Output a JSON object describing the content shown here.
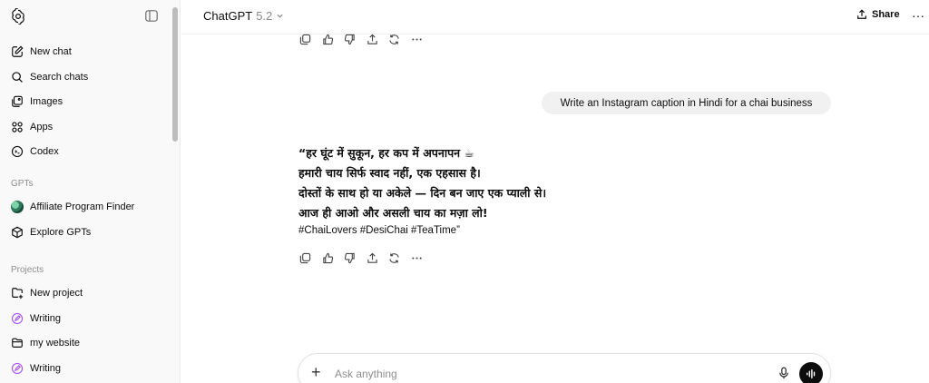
{
  "sidebar": {
    "nav": [
      {
        "label": "New chat",
        "icon": "new-chat-icon"
      },
      {
        "label": "Search chats",
        "icon": "search-icon"
      },
      {
        "label": "Images",
        "icon": "images-icon"
      },
      {
        "label": "Apps",
        "icon": "apps-icon"
      },
      {
        "label": "Codex",
        "icon": "codex-icon"
      }
    ],
    "gpts_title": "GPTs",
    "gpts": [
      {
        "label": "Affiliate Program Finder",
        "icon": "gpt-avatar"
      },
      {
        "label": "Explore GPTs",
        "icon": "explore-gpts-icon"
      }
    ],
    "projects_title": "Projects",
    "projects": [
      {
        "label": "New project",
        "icon": "new-project-icon"
      },
      {
        "label": "Writing",
        "icon": "writing-icon"
      },
      {
        "label": "my website",
        "icon": "folder-icon"
      },
      {
        "label": "Writing",
        "icon": "writing-icon"
      }
    ]
  },
  "header": {
    "model_name": "ChatGPT",
    "model_version": "5.2",
    "share_label": "Share",
    "more_label": "···"
  },
  "chat": {
    "user_message": "Write an Instagram caption in Hindi for a chai business",
    "reply_lines": [
      "“हर घूंट में सुकून, हर कप में अपनापन ☕",
      "हमारी चाय सिर्फ स्वाद नहीं, एक एहसास है।",
      "दोस्तों के साथ हो या अकेले — दिन बन जाए एक प्याली से।",
      "आज ही आओ और असली चाय का मज़ा लो!"
    ],
    "hashtags": "#ChaiLovers #DesiChai #TeaTime”"
  },
  "composer": {
    "placeholder": "Ask anything",
    "plus_label": "+"
  },
  "colors": {
    "sidebar_bg": "#f9f9f9",
    "bubble_bg": "#f1f1f1",
    "writing_icon": "#a855f7",
    "voice_button": "#0d0d0d"
  }
}
